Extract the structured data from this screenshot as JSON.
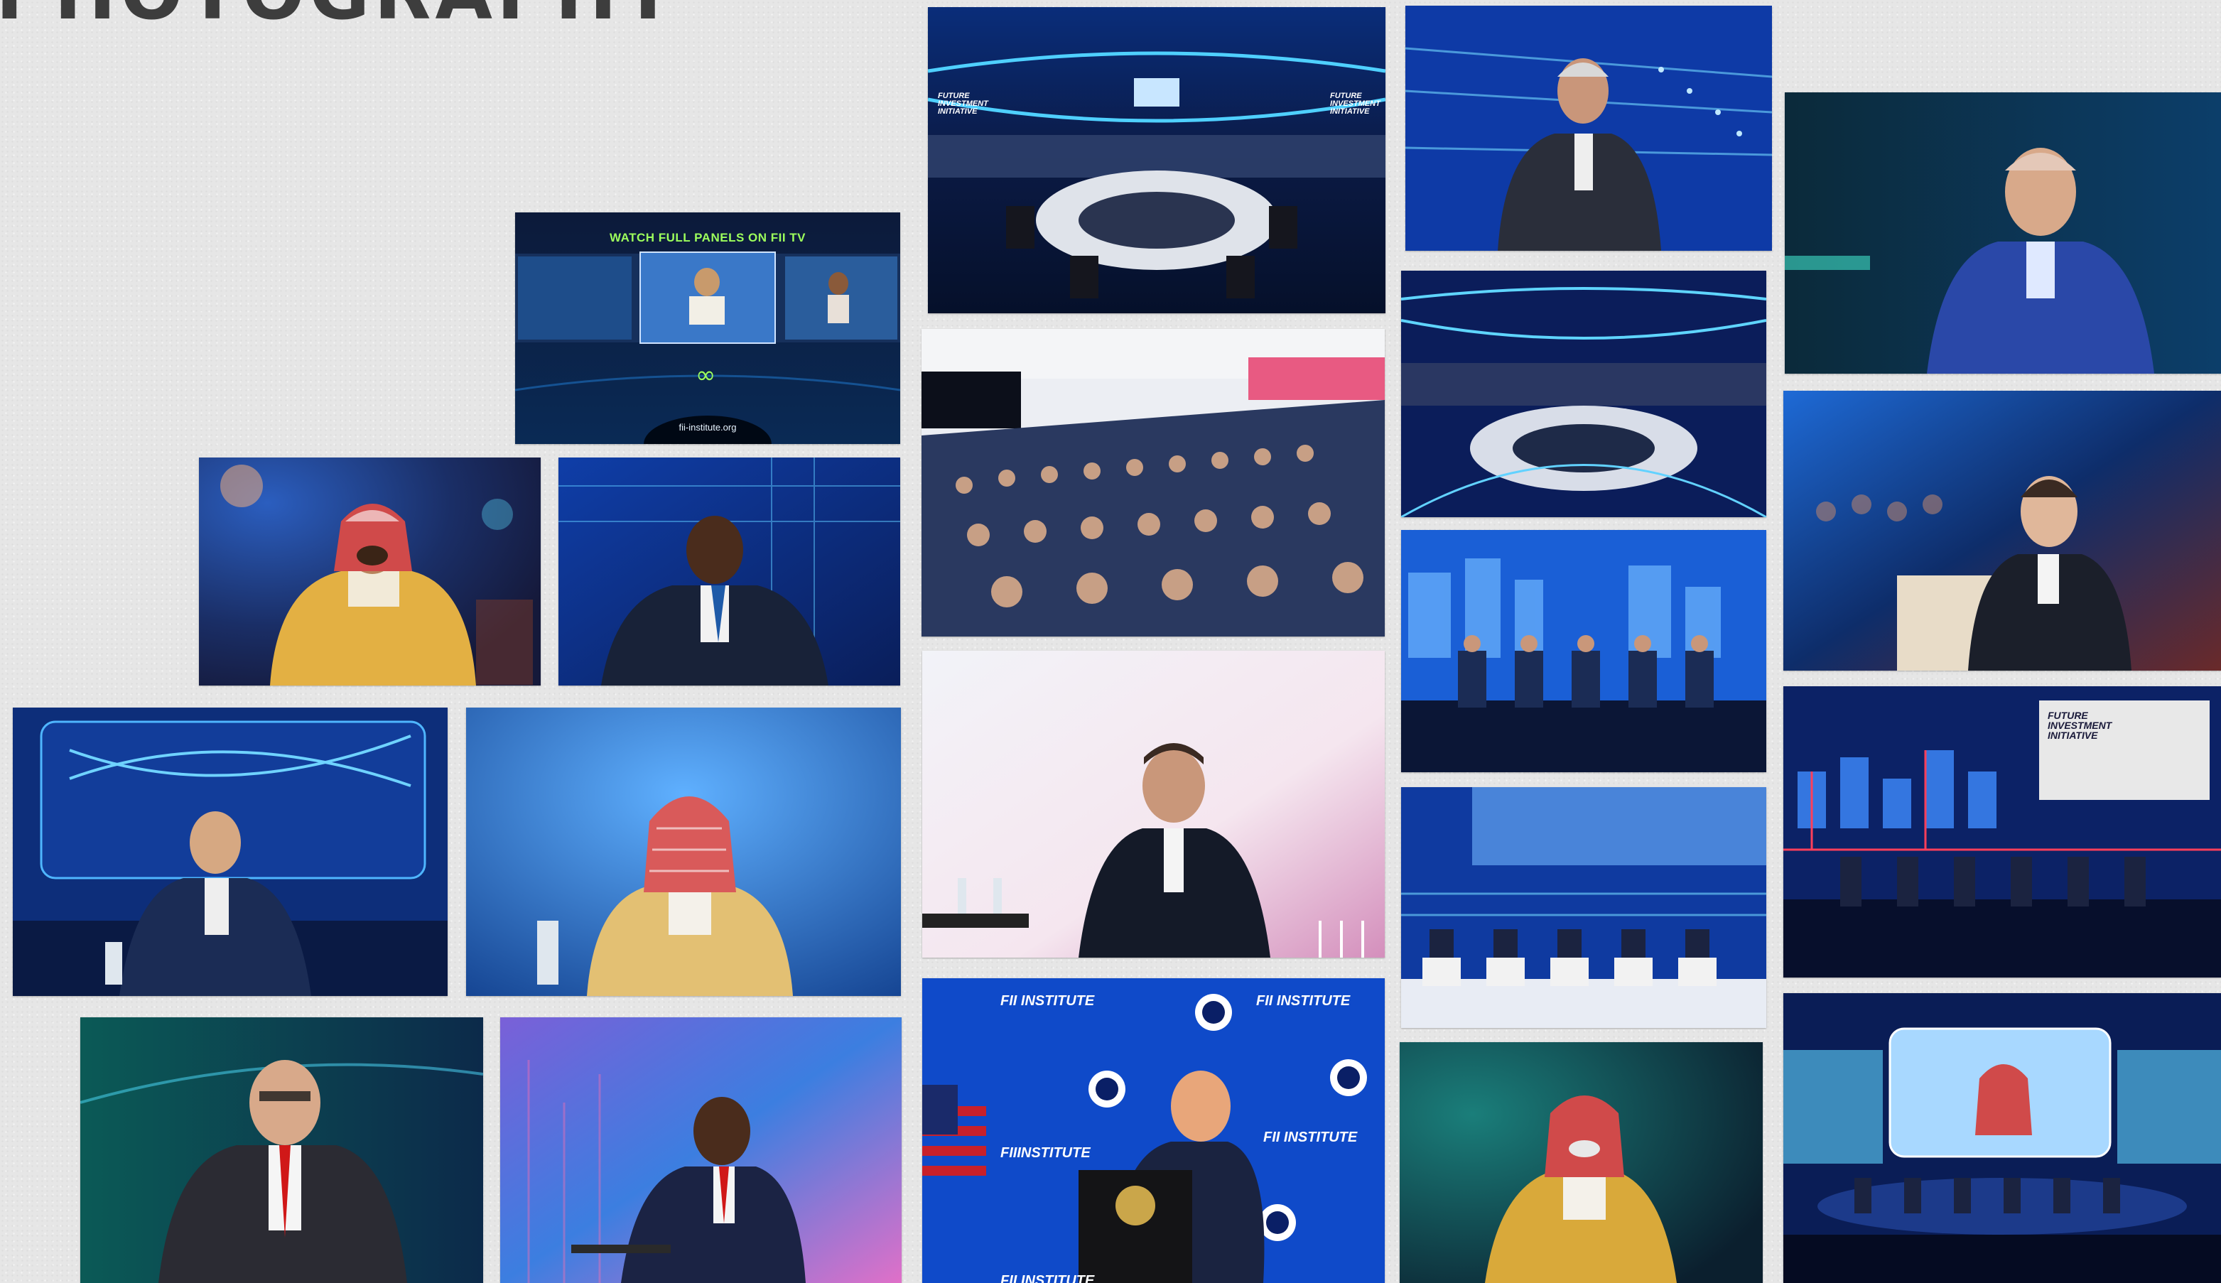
{
  "page": {
    "heading": "PHOTOGRAPHY"
  },
  "promo": {
    "title": "WATCH FULL PANELS ON FII TV",
    "url": "fii-institute.org"
  },
  "stage_branding": {
    "fii_institute": "FII INSTITUTE",
    "fii_institute_b": "FII INSTITUTE",
    "fii_institute_c": "FII INSTITUTE",
    "fii_institute_d": "FIIINSTITUTE",
    "fii_institute_e": "FII INSTITUTE",
    "future": "FUTURE INVESTMENT INITIATIVE",
    "future_b": "FUTURE INVESTMENT INITIATIVE",
    "future_c": "FUTURE INVESTMENT INITIATIVE"
  },
  "gallery": {
    "photos": [
      "panel-arena-photo",
      "speaker-standing-photo",
      "speaker-blue-jacket-photo",
      "fii-tv-promo",
      "arena-audience-photo",
      "speaker-thobe-gold-photo",
      "speaker-dark-suit-photo",
      "audience-hall-photo",
      "speaker-woman-photo",
      "panel-stage-photo",
      "speaker-young-suit-photo",
      "speaker-ghutra-photo",
      "speaker-hand-raised-photo",
      "panel-five-chairs-photo",
      "panel-circuit-stage-photo",
      "speaker-red-tie-photo",
      "speaker-crossed-arms-photo",
      "president-podium-photo",
      "speaker-gold-bisht-photo",
      "panel-wide-stage-photo"
    ]
  },
  "colors": {
    "background": "#e6e6e6",
    "heading": "#3d3d3d",
    "stage_blue": "#1b5fd6",
    "deep_navy": "#0b1840",
    "accent_green": "#9dff5c",
    "gold": "#d9a93a"
  }
}
